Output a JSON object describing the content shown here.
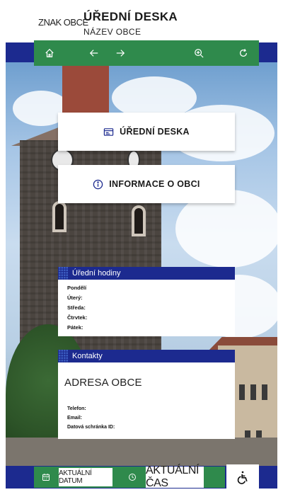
{
  "header": {
    "logo_text": "ZNAK OBCE",
    "title": "ÚŘEDNÍ DESKA",
    "subtitle": "NÁZEV OBCE"
  },
  "nav": {
    "icons": [
      "home-icon",
      "arrow-left-icon",
      "arrow-right-icon",
      "zoom-in-icon",
      "refresh-icon"
    ]
  },
  "buttons": {
    "uredni_deska": "ÚŘEDNÍ DESKA",
    "informace": "INFORMACE O OBCI"
  },
  "hours": {
    "title": "Úřední hodiny",
    "days": [
      "Pondělí",
      "Úterý:",
      "Středa:",
      "Čtrvtek:",
      "Pátek:"
    ]
  },
  "contacts": {
    "title": "Kontakty",
    "address": "ADRESA OBCE",
    "rows": [
      "Telefon:",
      "Email:",
      "Datová schránka ID:"
    ]
  },
  "footer": {
    "date": "AKTUÁLNÍ DATUM",
    "time": "AKTUÁLNÍ ČAS"
  },
  "colors": {
    "brand_blue": "#1c2a8f",
    "brand_green": "#2f8a4c"
  }
}
